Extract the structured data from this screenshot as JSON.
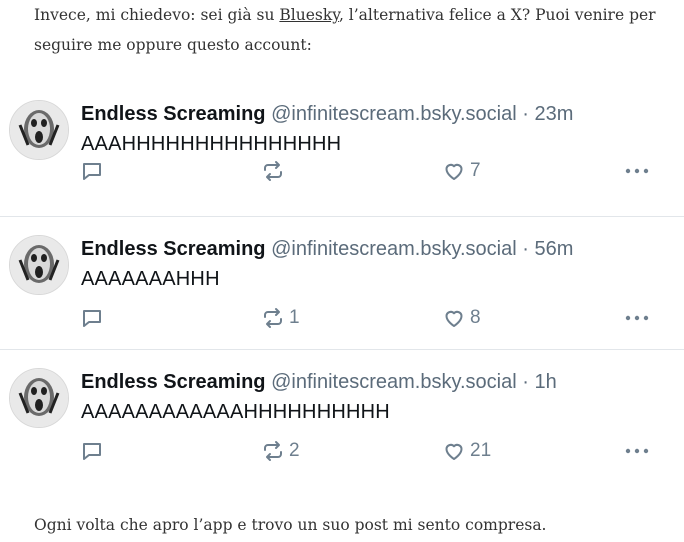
{
  "intro": {
    "before": "Invece, mi chiedevo: sei già su ",
    "link": "Bluesky",
    "after": ", l’alternativa felice a X? Puoi venire per seguire me oppure questo account:"
  },
  "posts": [
    {
      "author": "Endless Screaming",
      "handle": "@infinitescream.bsky.social",
      "separator": "·",
      "time": "23m",
      "text": "AAAHHHHHHHHHHHHHHH",
      "reply_count": "",
      "repost_count": "",
      "like_count": "7"
    },
    {
      "author": "Endless Screaming",
      "handle": "@infinitescream.bsky.social",
      "separator": "·",
      "time": "56m",
      "text": "AAAAAAAHHH",
      "reply_count": "",
      "repost_count": "1",
      "like_count": "8"
    },
    {
      "author": "Endless Screaming",
      "handle": "@infinitescream.bsky.social",
      "separator": "·",
      "time": "1h",
      "text": "AAAAAAAAAAAAHHHHHHHHHH",
      "reply_count": "",
      "repost_count": "2",
      "like_count": "21"
    }
  ],
  "outro": "Ogni volta che apro l’app e trovo un suo post mi sento compresa.",
  "icons": [
    "reply-icon",
    "repost-icon",
    "heart-icon",
    "more-icon"
  ],
  "colors": {
    "text": "#333333",
    "author": "#101418",
    "meta": "#5b6b7a",
    "action": "#6e7f8e",
    "divider": "#e2e6ea"
  }
}
